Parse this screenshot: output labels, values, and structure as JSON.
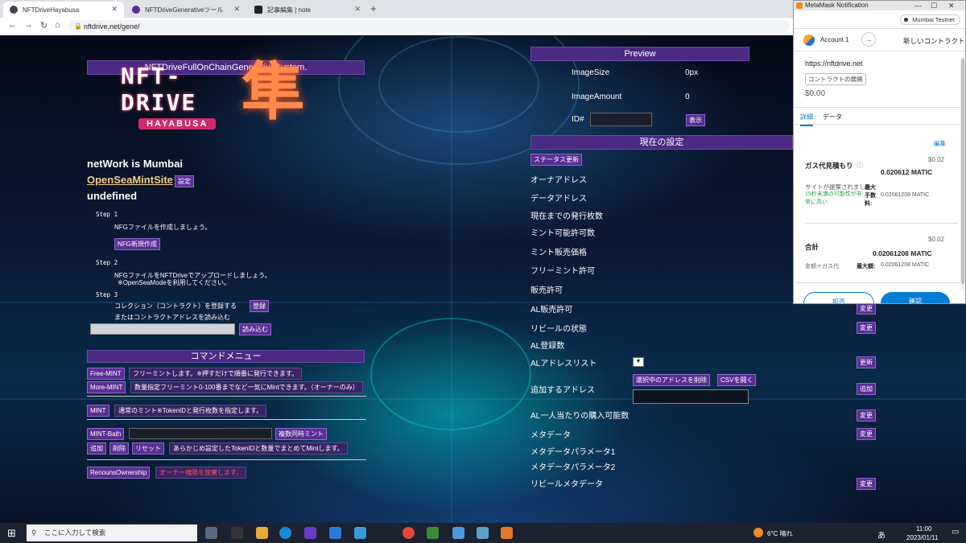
{
  "browser": {
    "tabs": [
      {
        "title": "NFTDriveHayabusa",
        "active": true
      },
      {
        "title": "NFTDriveGenerativeツール",
        "active": false
      },
      {
        "title": "記事編集 | note",
        "active": false
      }
    ],
    "url": "nftdrive.net/gene/",
    "new_tab": "+"
  },
  "left": {
    "header": "NFTDriveFullOnChainGenerativeSystem.",
    "logo_main": "NFT-DRIVE",
    "logo_sub": "HAYABUSA",
    "logo_kanji": "隼",
    "network": "netWork is Mumbai",
    "opensea_link": "OpenSeaMintSite",
    "settings_btn": "設定",
    "undefined_text": "undefined",
    "step1_label": "Step 1",
    "step1_text": "NFGファイルを作成しましょう。",
    "nfg_btn": "NFG新規作成",
    "step2_label": "Step 2",
    "step2_text": "NFGファイルをNFTDriveでアップロードしましょう。",
    "step2_note": "※OpenSeaModeを利用してください。",
    "step3_label": "Step 3",
    "step3_text": "コレクション（コントラクト）を登録する",
    "register_btn": "登録",
    "step3_or": "またはコントラクトアドレスを読み込む",
    "load_btn": "読み込む",
    "command_header": "コマンドメニュー",
    "free_mint_btn": "Free-MINT",
    "free_mint_desc": "フリーミントします。※押すだけで順番に発行できます。",
    "more_mint_btn": "More-MINT",
    "more_mint_desc": "数量指定フリーミント0-100番までなど一気にMintできます。（オーナーのみ）",
    "mint_btn": "MINT",
    "mint_desc": "通常のミント※TokenIDと発行枚数を指定します。",
    "mint_bath_btn": "MINT-Bath",
    "multi_mint_btn": "複数同時ミント",
    "add_btn": "追加",
    "delete_btn": "削除",
    "reset_btn": "リセット",
    "bath_desc": "あらかじめ設定したTokenIDと数量でまとめてMintします。",
    "renounce_btn": "RenounsOwnership",
    "renounce_desc": "オーナー権限を放棄します。"
  },
  "right": {
    "preview_header": "Preview",
    "image_size_label": "ImageSize",
    "image_size_value": "0px",
    "image_amount_label": "ImageAmount",
    "image_amount_value": "0",
    "id_label": "ID#",
    "show_btn": "表示",
    "settings_header": "現在の設定",
    "status_btn": "ステータス更新",
    "rows": {
      "owner": "オーナアドレス",
      "data_address": "データアドレス",
      "issued": "現在までの発行枚数",
      "mint_allowed": "ミント可能許可数",
      "mint_price": "ミント販売価格",
      "free_mint": "フリーミント許可",
      "sale_allowed": "販売許可",
      "al_sale": "AL販売許可",
      "reveal_state": "リビールの状態",
      "al_count": "AL登録数",
      "al_list": "ALアドレスリスト",
      "add_address": "追加するアドレス",
      "al_per_person": "AL一人当たりの購入可能数",
      "metadata": "メタデータ",
      "metadata_param1": "メタデータパラメータ1",
      "metadata_param2": "メタデータパラメータ2",
      "reveal_metadata": "リビールメタデータ"
    },
    "change_btn": "変更",
    "update_btn": "更新",
    "add_btn": "追加",
    "delete_selected_btn": "選択中のアドレスを削除",
    "open_csv_btn": "CSVを開く",
    "select_arrow": "▼"
  },
  "metamask": {
    "title": "MetaMask Notification",
    "network": "Mumbai Testnet",
    "account": "Account 1",
    "new_contract": "新しいコントラクト",
    "origin": "https://nftdrive.net",
    "deploy_badge": "コントラクトの展開",
    "amount": "$0.00",
    "tab_details": "詳細",
    "tab_data": "データ",
    "edit": "編集",
    "gas_usd": "$0.02",
    "gas_label": "ガス代見積もり",
    "gas_value": "0.020612 MATIC",
    "site_suggested": "サイトが提案されました",
    "likely": "15秒未満の可能性が非常に高い",
    "max_fee_label": "最大手数料:",
    "max_fee_value": "0.02061208 MATIC",
    "total_usd": "$0.02",
    "total_label": "合計",
    "total_value": "0.02061208 MATIC",
    "amount_gas": "金額＋ガス代",
    "max_amount_label": "最大額:",
    "max_amount_value": "0.02061208 MATIC",
    "reject": "拒否",
    "confirm": "確認"
  },
  "taskbar": {
    "search_placeholder": "ここに入力して検索",
    "weather": "6°C 晴れ",
    "ime": "あ",
    "time": "11:00",
    "date": "2023/01/11"
  },
  "colors": {
    "accent_purple": "#4a2a82",
    "metamask_blue": "#037dd6",
    "error_red": "#ff5050"
  }
}
